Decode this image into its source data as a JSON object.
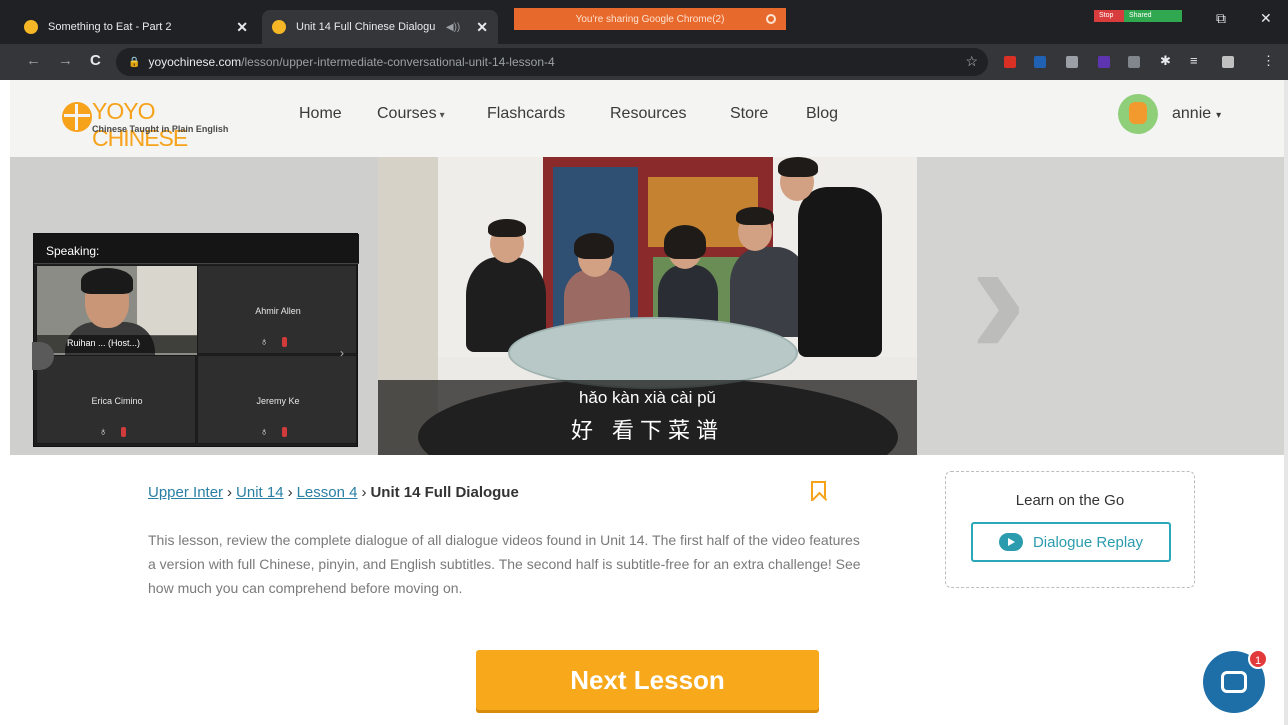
{
  "browser": {
    "tabs": [
      {
        "title": "Something to Eat - Part 2",
        "active": false
      },
      {
        "title": "Unit 14 Full Chinese Dialogu",
        "active": true
      }
    ],
    "close_glyph": "✕",
    "audio_glyph": "◀))",
    "share_banner": "You're sharing Google Chrome(2)",
    "zoom_buttons": [
      "Stop",
      "Shared"
    ],
    "window_controls": {
      "maximize": "⧉",
      "close": "✕"
    },
    "nav": {
      "back": "←",
      "forward": "→",
      "reload": "C"
    },
    "url_host": "yoyochinese.com",
    "url_path": "/lesson/upper-intermediate-conversational-unit-14-lesson-4",
    "lock_glyph": "🔒",
    "star_glyph": "☆",
    "extension_icons": [
      "abp-icon",
      "screen-icon",
      "tab-icon",
      "b-icon",
      "reader-icon",
      "puzzle-icon",
      "playlist-icon",
      "translate-icon",
      "menu-icon"
    ],
    "accent": "#e8692c"
  },
  "site": {
    "brand": "YOYO CHINESE",
    "tagline": "Chinese Taught in Plain English",
    "nav": [
      {
        "label": "Home"
      },
      {
        "label": "Courses",
        "dropdown": true
      },
      {
        "label": "Flashcards"
      },
      {
        "label": "Resources"
      },
      {
        "label": "Store"
      },
      {
        "label": "Blog"
      }
    ],
    "caret": "▾",
    "user": "annie",
    "brand_color": "#f6a21b"
  },
  "video": {
    "pinyin": "hǎo  kàn xià cài pǔ",
    "hanzi": "好 看下菜谱"
  },
  "zoom": {
    "speaking_label": "Speaking:",
    "host_caption": "Ruihan ...  (Host...)",
    "participants": [
      {
        "name": "Ahmir Allen"
      },
      {
        "name": "Erica Cimino"
      },
      {
        "name": "Jeremy Ke"
      }
    ],
    "mic_glyph": "♁",
    "next_glyph": "›"
  },
  "lesson": {
    "breadcrumb": [
      {
        "label": "Upper Inter",
        "link": true
      },
      {
        "label": "Unit 14",
        "link": true
      },
      {
        "label": "Lesson 4",
        "link": true
      },
      {
        "label": "Unit 14 Full Dialogue",
        "link": false
      }
    ],
    "crumb_sep": "›",
    "description": "This lesson, review the complete dialogue of all dialogue videos found in Unit 14. The first half of the video features a version with full Chinese, pinyin, and English subtitles. The second half is subtitle-free for an extra challenge! See how much you can comprehend before moving on.",
    "next_button": "Next Lesson",
    "learn_title": "Learn on the Go",
    "replay_button": "Dialogue Replay",
    "button_color": "#f7a81b",
    "replay_color": "#2a9cad"
  },
  "chat": {
    "badge_count": "1"
  },
  "hero": {
    "prev_glyph": "‹",
    "next_glyph": "›"
  }
}
